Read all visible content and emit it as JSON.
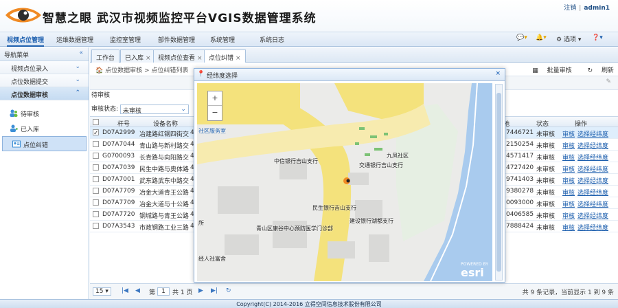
{
  "header": {
    "brand": "智慧之眼",
    "system_title": "武汉市视频监控平台VGIS数据管理系统",
    "logout": "注销",
    "user": "admin1"
  },
  "menu": {
    "items": [
      "视频点位管理",
      "运维数据管理",
      "监控室管理",
      "部件数据管理",
      "系统管理",
      "系统日志"
    ],
    "right": {
      "chat": "",
      "alert": "",
      "options": "选项",
      "help": ""
    }
  },
  "sidebar": {
    "title": "导航菜单",
    "groups": [
      "视频点位录入",
      "点位数据提交",
      "点位数据审核"
    ],
    "items": [
      "待审核",
      "已入库",
      "点位纠错"
    ]
  },
  "tabs": [
    "工作台",
    "已入库",
    "视频点位查看",
    "点位纠错"
  ],
  "breadcrumb": "点位数据审核 > 点位纠错列表",
  "toolbar": {
    "batch": "批量审核",
    "refresh": "刷新"
  },
  "section_title": "待审核",
  "filter": {
    "label": "审核状态:",
    "value": "未审核"
  },
  "grid": {
    "headers": [
      "",
      "杆号",
      "设备名称",
      "地",
      "状态",
      "操作"
    ],
    "rows": [
      {
        "id": "D07A2999",
        "name": "冶建路红钢四街交",
        "n": "4",
        "code": "74467218",
        "status": "未审核",
        "act1": "审核",
        "act2": "选择经纬度"
      },
      {
        "id": "D07A7044",
        "name": "青山路与新村路交",
        "n": "4",
        "code": "21502540",
        "status": "未审核",
        "act1": "审核",
        "act2": "选择经纬度"
      },
      {
        "id": "G0700093",
        "name": "长青路与向阳路交",
        "n": "4",
        "code": "45714175",
        "status": "未审核",
        "act1": "审核",
        "act2": "选择经纬度"
      },
      {
        "id": "D07A7039",
        "name": "民生中路与奥体路",
        "n": "4",
        "code": "47274207",
        "status": "未审核",
        "act1": "审核",
        "act2": "选择经纬度"
      },
      {
        "id": "D07A7001",
        "name": "武东路武东中路交",
        "n": "4",
        "code": "97414036",
        "status": "未审核",
        "act1": "审核",
        "act2": "选择经纬度"
      },
      {
        "id": "D07A7709",
        "name": "冶金大道青王公路",
        "n": "4",
        "code": "93802785",
        "status": "未审核",
        "act1": "审核",
        "act2": "选择经纬度"
      },
      {
        "id": "D07A7709",
        "name": "冶金大道与十公路",
        "n": "4",
        "code": "00930005",
        "status": "未审核",
        "act1": "审核",
        "act2": "选择经纬度"
      },
      {
        "id": "D07A7720",
        "name": "钢城路与青王公路",
        "n": "4",
        "code": "04065855",
        "status": "未审核",
        "act1": "审核",
        "act2": "选择经纬度"
      },
      {
        "id": "D07A3543",
        "name": "市政钢路工业三路",
        "n": "4",
        "code": "78884246",
        "status": "未审核",
        "act1": "审核",
        "act2": "选择经纬度"
      }
    ]
  },
  "pager": {
    "size": "15",
    "page_prefix": "第",
    "page": "1",
    "page_total": "共 1 页",
    "summary": "共 9 条记录，当前显示 1 到 9 条"
  },
  "dialog": {
    "title": "经纬度选择",
    "labels": {
      "l1": "社区服务室",
      "l2": "中信银行吉山支行",
      "l3": "交通银行吉山支行",
      "l4": "九凤社区",
      "l5": "民生银行吉山支行",
      "l6": "青山区康谷中心预防医学门诊部",
      "l7": "建设银行湖都支行",
      "l8": "经人社富舍",
      "l9": "所",
      "zin": "+",
      "zout": "−",
      "esri": "esri",
      "powered": "POWERED BY"
    }
  },
  "footer": "Copyright(C) 2014-2016 立得空间信息技术股份有限公司",
  "colors": {
    "brand": "#1d5fae",
    "header_bg": "#dbe7f5",
    "road_yellow": "#f4e27c",
    "water": "#a9cbee"
  }
}
